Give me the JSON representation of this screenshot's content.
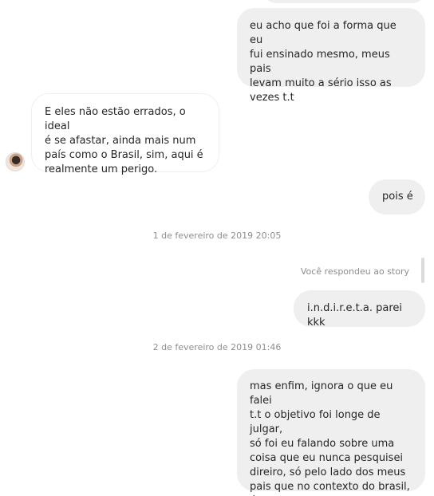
{
  "messages": [
    {
      "id": "msg-1",
      "direction": "outgoing",
      "text": "eu acho que foi a forma que eu\nfui ensinado mesmo, meus pais\nlevam muito a sério isso as\nvezes t.t"
    },
    {
      "id": "msg-2",
      "direction": "incoming",
      "text": "E eles não estão errados, o ideal\né se afastar, ainda mais num\npaís como o Brasil, sim, aqui é\nrealmente um perigo."
    },
    {
      "id": "msg-3",
      "direction": "outgoing",
      "text": "pois é"
    },
    {
      "id": "msg-4",
      "direction": "outgoing",
      "text": "i.n.d.i.r.e.t.a. parei kkk"
    },
    {
      "id": "msg-5",
      "direction": "outgoing",
      "text": "mas enfim, ignora o que eu falei\nt.t o objetivo foi longe de julgar,\nsó foi eu falando sobre uma\ncoisa que eu nunca pesquisei\ndireiro, só pelo lado dos meus\npais que no contexto do brasil, é\ndifícil"
    }
  ],
  "timestamps": {
    "first": "1 de fevereiro de 2019 20:05",
    "second": "2 de fevereiro de 2019 01:46"
  },
  "story_reply_label": "Você respondeu ao story",
  "colors": {
    "outgoing_bubble": "#efefef",
    "incoming_border": "#efefef",
    "meta_text": "#8e8e8e",
    "text": "#262626"
  }
}
